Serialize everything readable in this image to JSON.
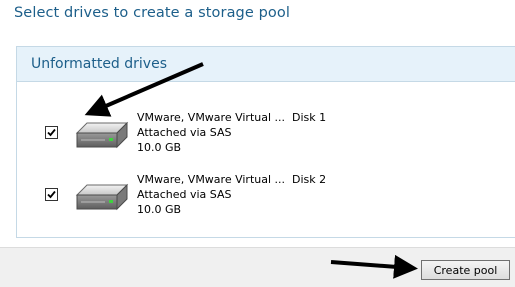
{
  "header": {
    "title": "Select drives to create a storage pool"
  },
  "group": {
    "title": "Unformatted drives",
    "drives": [
      {
        "checked": true,
        "name": "VMware, VMware Virtual ...",
        "disk": "Disk 1",
        "connection": "Attached via SAS",
        "size": "10.0 GB",
        "icon": "hard-drive-icon"
      },
      {
        "checked": true,
        "name": "VMware, VMware Virtual ...",
        "disk": "Disk 2",
        "connection": "Attached via SAS",
        "size": "10.0 GB",
        "icon": "hard-drive-icon"
      }
    ]
  },
  "footer": {
    "create_label": "Create pool"
  },
  "colors": {
    "title": "#1d5f8a",
    "header_bg": "#e6f2fa",
    "footer_bg": "#f0f0f0",
    "annotation_arrow": "#000000"
  }
}
